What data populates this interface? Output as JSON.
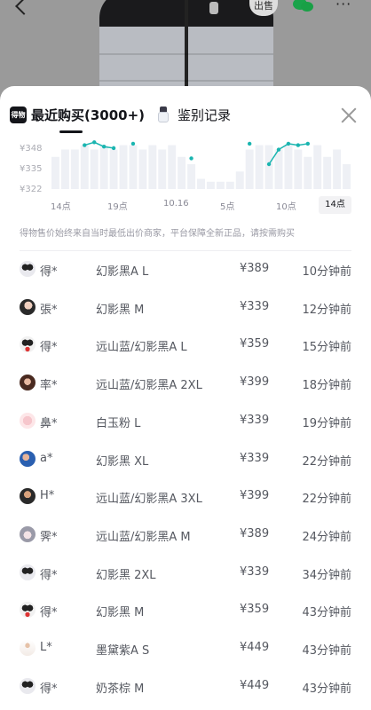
{
  "header": {
    "sell_badge": "出售",
    "more": "···"
  },
  "tabs": [
    {
      "label": "最近购买(3000+)",
      "icon": "dewu-app-icon",
      "icon_text": "得物",
      "active": true
    },
    {
      "label": "鉴别记录",
      "icon": "bottle-icon",
      "active": false
    }
  ],
  "chart_data": {
    "type": "bar",
    "title": "",
    "y_ticks": [
      "¥348",
      "¥335",
      "¥322"
    ],
    "x_ticks": [
      "14点",
      "19点",
      "10.16",
      "5点",
      "10点",
      "14点"
    ],
    "active_x_tick": "14点",
    "bars": [
      340,
      345,
      345,
      348,
      345,
      348,
      345,
      348,
      348,
      345,
      348,
      345,
      348,
      340,
      335,
      325,
      323,
      323,
      323,
      330,
      345,
      348,
      348,
      345,
      348,
      345,
      340,
      348,
      340,
      345,
      335
    ],
    "line": [
      null,
      null,
      null,
      348,
      350,
      347,
      346,
      null,
      349,
      null,
      null,
      null,
      null,
      null,
      339,
      null,
      null,
      null,
      null,
      null,
      349,
      null,
      335,
      345,
      349,
      348,
      349,
      null,
      null,
      null,
      null,
      null
    ],
    "ylim": [
      318,
      352
    ],
    "colors": {
      "bar": "#eef0f5",
      "line": "#1ab5b0"
    }
  },
  "note": "得物售价始终来自当时最低出价商家，平台保障全新正品，请按需购买",
  "purchases": [
    {
      "user": "得*",
      "avatar": "avatar-panda",
      "sku": "幻影黑A L",
      "price": "¥389",
      "time": "10分钟前"
    },
    {
      "user": "張*",
      "avatar": "avatar-girl",
      "sku": "幻影黑 M",
      "price": "¥339",
      "time": "12分钟前"
    },
    {
      "user": "得*",
      "avatar": "avatar-panda-red",
      "sku": "远山蓝/幻影黑A L",
      "price": "¥359",
      "time": "15分钟前"
    },
    {
      "user": "率*",
      "avatar": "avatar-photo-woman",
      "sku": "远山蓝/幻影黑A 2XL",
      "price": "¥399",
      "time": "18分钟前"
    },
    {
      "user": "鼻*",
      "avatar": "avatar-pink",
      "sku": "白玉粉 L",
      "price": "¥339",
      "time": "19分钟前"
    },
    {
      "user": "a*",
      "avatar": "avatar-photo-blue",
      "sku": "幻影黑 XL",
      "price": "¥339",
      "time": "22分钟前"
    },
    {
      "user": "H*",
      "avatar": "avatar-photo-dark",
      "sku": "远山蓝/幻影黑A 3XL",
      "price": "¥399",
      "time": "22分钟前"
    },
    {
      "user": "霁*",
      "avatar": "avatar-anime",
      "sku": "远山蓝/幻影黑A M",
      "price": "¥389",
      "time": "24分钟前"
    },
    {
      "user": "得*",
      "avatar": "avatar-panda",
      "sku": "幻影黑 2XL",
      "price": "¥339",
      "time": "34分钟前"
    },
    {
      "user": "得*",
      "avatar": "avatar-panda-red",
      "sku": "幻影黑 M",
      "price": "¥359",
      "time": "43分钟前"
    },
    {
      "user": "L*",
      "avatar": "avatar-figure",
      "sku": "墨黛紫A S",
      "price": "¥449",
      "time": "43分钟前"
    },
    {
      "user": "得*",
      "avatar": "avatar-panda",
      "sku": "奶茶棕 M",
      "price": "¥449",
      "time": "43分钟前"
    }
  ]
}
